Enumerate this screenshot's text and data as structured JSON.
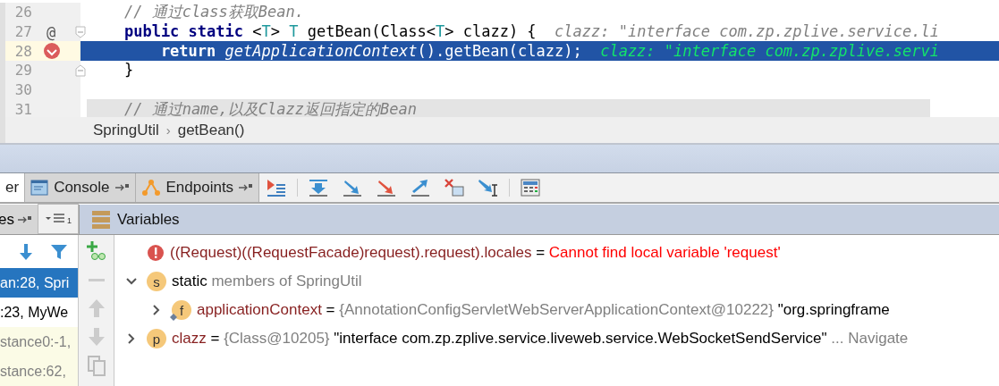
{
  "editor": {
    "lines": [
      {
        "number": "26",
        "current": false,
        "breakpoint": false,
        "shaded": false,
        "fold_start": false,
        "fold_end": false,
        "segments": [
          {
            "kind": "comment",
            "text": "    // 通过class获取Bean."
          }
        ]
      },
      {
        "number": "27",
        "current": false,
        "breakpoint": false,
        "shaded": false,
        "fold_start": true,
        "fold_end": false,
        "gutter_mark": "@",
        "segments": [
          {
            "kind": "keyword",
            "text": "    public static"
          },
          {
            "kind": "plain",
            "text": " <"
          },
          {
            "kind": "type",
            "text": "T"
          },
          {
            "kind": "plain",
            "text": "> "
          },
          {
            "kind": "type",
            "text": "T"
          },
          {
            "kind": "plain",
            "text": " getBean(Class<"
          },
          {
            "kind": "type",
            "text": "T"
          },
          {
            "kind": "plain",
            "text": "> clazz) {  "
          },
          {
            "kind": "hint",
            "text": "clazz: \"interface com.zp.zplive.service.li"
          }
        ]
      },
      {
        "number": "28",
        "current": true,
        "breakpoint": true,
        "shaded": false,
        "fold_start": false,
        "fold_end": false,
        "segments": [
          {
            "kind": "keyword",
            "text": "        return"
          },
          {
            "kind": "call",
            "text": " getApplicationContext"
          },
          {
            "kind": "plain",
            "text": "().getBean(clazz);  "
          },
          {
            "kind": "hint",
            "text": "clazz: \"interface com.zp.zplive.servi"
          }
        ]
      },
      {
        "number": "29",
        "current": false,
        "breakpoint": false,
        "shaded": false,
        "fold_start": false,
        "fold_end": true,
        "segments": [
          {
            "kind": "plain",
            "text": "    }"
          }
        ]
      },
      {
        "number": "30",
        "current": false,
        "breakpoint": false,
        "shaded": false,
        "fold_start": false,
        "fold_end": false
      },
      {
        "number": "31",
        "current": false,
        "breakpoint": false,
        "shaded": true,
        "fold_start": false,
        "fold_end": false,
        "segments": [
          {
            "kind": "comment",
            "text": "    // 通过name,以及Clazz返回指定的Bean"
          }
        ]
      }
    ]
  },
  "breadcrumb": {
    "items": [
      "SpringUtil",
      "getBean()"
    ],
    "separator": "›"
  },
  "tabs": [
    {
      "label": "er",
      "selected": true
    },
    {
      "label": "Console",
      "selected": false,
      "kind": "console"
    },
    {
      "label": "Endpoints",
      "selected": false,
      "kind": "endpoints"
    }
  ],
  "frames_tab": {
    "label": "es"
  },
  "frames_selector": {
    "badge": "1"
  },
  "variables_header": {
    "title": "Variables"
  },
  "frames": [
    {
      "text": "an:28, Spri",
      "selected": true,
      "library": false
    },
    {
      "text": ":23, MyWe",
      "selected": false,
      "library": false
    },
    {
      "text": "stance0:-1,",
      "selected": false,
      "library": true
    },
    {
      "text": "stance:62,",
      "selected": false,
      "library": true
    }
  ],
  "variables": [
    {
      "kind": "error",
      "name": "((Request)((RequestFacade)request).request).locales",
      "op": "=",
      "message": "Cannot find local variable 'request'"
    },
    {
      "kind": "static",
      "badge": "s",
      "expanded": true,
      "keyword": "static",
      "label": "members of SpringUtil",
      "children": [
        {
          "kind": "field",
          "badge": "f",
          "expanded": false,
          "name": "applicationContext",
          "op": "=",
          "type": "{AnnotationConfigServletWebServerApplicationContext@10222}",
          "value": "\"org.springframe"
        }
      ]
    },
    {
      "kind": "param",
      "badge": "p",
      "expanded": false,
      "name": "clazz",
      "op": "=",
      "type": "{Class@10205}",
      "value": "\"interface com.zp.zplive.service.liveweb.service.WebSocketSendService\"",
      "link": "... Navigate"
    }
  ]
}
